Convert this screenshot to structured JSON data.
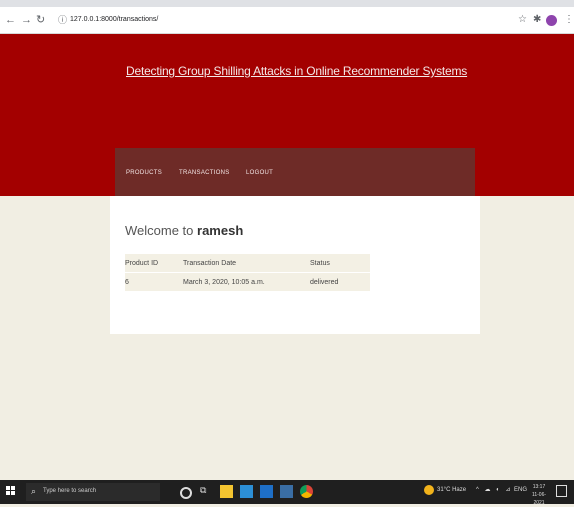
{
  "browser": {
    "url": "127.0.0.1:8000/transactions/"
  },
  "site": {
    "title": "Detecting Group Shilling Attacks in Online Recommender Systems",
    "nav": [
      "PRODUCTS",
      "TRANSACTIONS",
      "LOGOUT"
    ]
  },
  "page": {
    "welcome_prefix": "Welcome to ",
    "username": "ramesh",
    "table": {
      "headers": [
        "Product ID",
        "Transaction Date",
        "Status"
      ],
      "rows": [
        [
          "6",
          "March 3, 2020, 10:05 a.m.",
          "delivered"
        ]
      ]
    }
  },
  "taskbar": {
    "search_placeholder": "Type here to search",
    "weather": "31°C Haze",
    "language": "ENG",
    "time": "13:17",
    "date": "11-06-2021"
  },
  "colors": {
    "header_red": "#a30000",
    "navbar": "#6e2b27",
    "page_bg": "#f1eee3"
  }
}
